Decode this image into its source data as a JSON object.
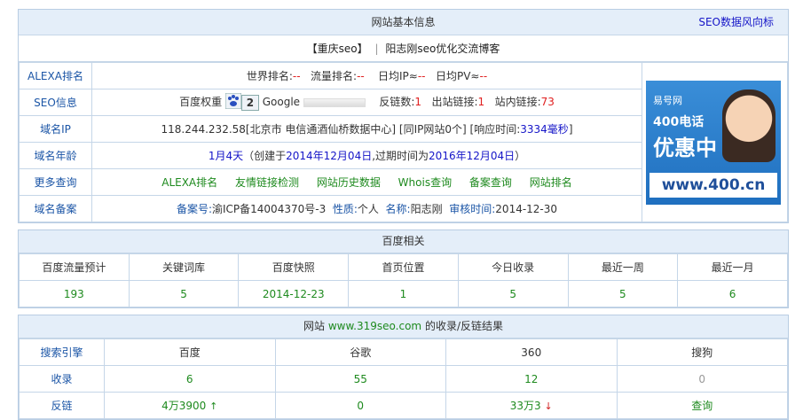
{
  "basic": {
    "header": "网站基本信息",
    "header_link": "SEO数据风向标",
    "site_name": "【重庆seo】",
    "separator": "|",
    "site_desc": "阳志刚seo优化交流博客",
    "rows": {
      "alexa": {
        "label": "ALEXA排名",
        "world_label": "世界排名:",
        "world_value": "--",
        "traffic_label": "流量排名:",
        "traffic_value": "--",
        "ip_label": "日均IP≈",
        "ip_value": "--",
        "pv_label": "日均PV≈",
        "pv_value": "--"
      },
      "seo": {
        "label": "SEO信息",
        "baidu_label": "百度权重",
        "baidu_rank": "2",
        "google_label": "Google",
        "backlinks_label": "反链数:",
        "backlinks_value": "1",
        "outlinks_label": "出站链接:",
        "outlinks_value": "1",
        "inlinks_label": "站内链接:",
        "inlinks_value": "73"
      },
      "ip": {
        "label": "域名IP",
        "address": "118.244.232.58[北京市 电信通酒仙桥数据中心]",
        "same_ip": "[同IP网站0个]",
        "resp_label": "[响应时间:",
        "resp_value": "3334毫秒",
        "resp_end": "]"
      },
      "age": {
        "label": "域名年龄",
        "age_value": "1月4天",
        "created_prefix": "（创建于",
        "created_date": "2014年12月04日",
        "expire_prefix": ",过期时间为",
        "expire_date": "2016年12月04日",
        "suffix": "）"
      },
      "more": {
        "label": "更多查询",
        "links": [
          "ALEXA排名",
          "友情链接检测",
          "网站历史数据",
          "Whois查询",
          "备案查询",
          "网站排名"
        ]
      },
      "beian": {
        "label": "域名备案",
        "no_label": "备案号:",
        "no_value": "渝ICP备14004370号-3",
        "nature_label": "性质:",
        "nature_value": "个人",
        "name_label": "名称:",
        "name_value": "阳志刚",
        "audit_label": "审核时间:",
        "audit_value": "2014-12-30"
      }
    },
    "ad": {
      "brand": "易号网",
      "line1": "400电话",
      "line2": "优惠中",
      "url": "www.400.cn"
    }
  },
  "baidu": {
    "header": "百度相关",
    "columns": [
      "百度流量预计",
      "关键词库",
      "百度快照",
      "首页位置",
      "今日收录",
      "最近一周",
      "最近一月"
    ],
    "values": [
      "193",
      "5",
      "2014-12-23",
      "1",
      "5",
      "5",
      "6"
    ]
  },
  "index": {
    "header_prefix": "网站",
    "header_site": "www.319seo.com",
    "header_suffix": "的收录/反链结果",
    "columns": [
      "搜索引擎",
      "百度",
      "谷歌",
      "360",
      "搜狗"
    ],
    "rows": [
      {
        "label": "收录",
        "values": [
          "6",
          "55",
          "12",
          "0"
        ]
      },
      {
        "label": "反链",
        "values": [
          "4万3900",
          "0",
          "33万3",
          "查询"
        ]
      }
    ],
    "trend_up": "↑",
    "trend_down": "↓",
    "colors": {
      "green": "#1e8a1e",
      "red": "#e02020",
      "blue": "#1515c8",
      "header_bg": "#e4eef9"
    }
  }
}
